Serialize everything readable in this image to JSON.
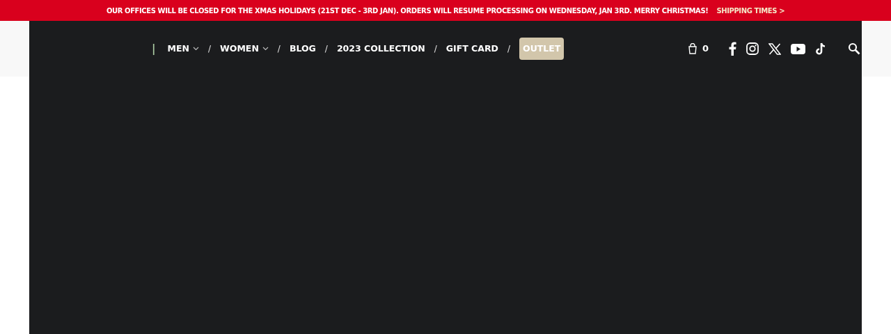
{
  "announcement": {
    "message": "OUR OFFICES WILL BE CLOSED FOR THE XMAS HOLIDAYS (21ST DEC - 3RD JAN). ORDERS WILL RESUME PROCESSING ON WEDNESDAY, JAN 3RD. MERRY CHRISTMAS!",
    "link": "SHIPPING TIMES >"
  },
  "nav": {
    "items": [
      {
        "separator": "|",
        "label": "MEN",
        "has_dropdown": true,
        "kind": "link"
      },
      {
        "separator": "/",
        "label": "WOMEN",
        "has_dropdown": true,
        "kind": "link"
      },
      {
        "separator": "/",
        "label": "BLOG",
        "has_dropdown": false,
        "kind": "link"
      },
      {
        "separator": "/",
        "label": "2023 COLLECTION",
        "has_dropdown": false,
        "kind": "link"
      },
      {
        "separator": "/",
        "label": "GIFT CARD",
        "has_dropdown": false,
        "kind": "link"
      },
      {
        "separator": "/",
        "label": "OUTLET",
        "has_dropdown": false,
        "kind": "highlight"
      }
    ]
  },
  "cart": {
    "count": "0"
  }
}
